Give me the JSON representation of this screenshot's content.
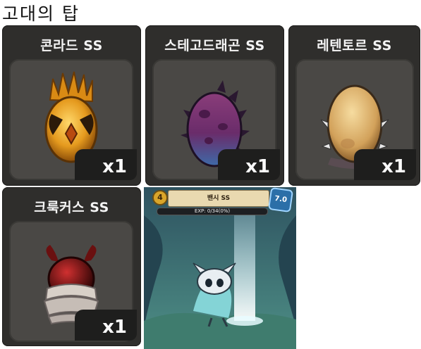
{
  "page": {
    "title": "고대의 탑"
  },
  "items": [
    {
      "name": "콘라드 SS",
      "quantity": "x1",
      "egg": "golden-horned-egg-icon"
    },
    {
      "name": "스테고드래곤 SS",
      "quantity": "x1",
      "egg": "purple-spiked-egg-icon"
    },
    {
      "name": "레텐토르 SS",
      "quantity": "x1",
      "egg": "tan-spiked-egg-icon"
    },
    {
      "name": "크룩커스 SS",
      "quantity": "x1",
      "egg": "red-bandaged-egg-icon"
    }
  ],
  "character_view": {
    "level": "4",
    "name": "밴시 SS",
    "rank": "7.0",
    "exp_text": "EXP: 0/34(0%)",
    "exp_percent": 0,
    "colors": {
      "card_bg": "#2f2e2c",
      "slot_bg": "#4a4845",
      "cave": "#3b6e78"
    }
  }
}
